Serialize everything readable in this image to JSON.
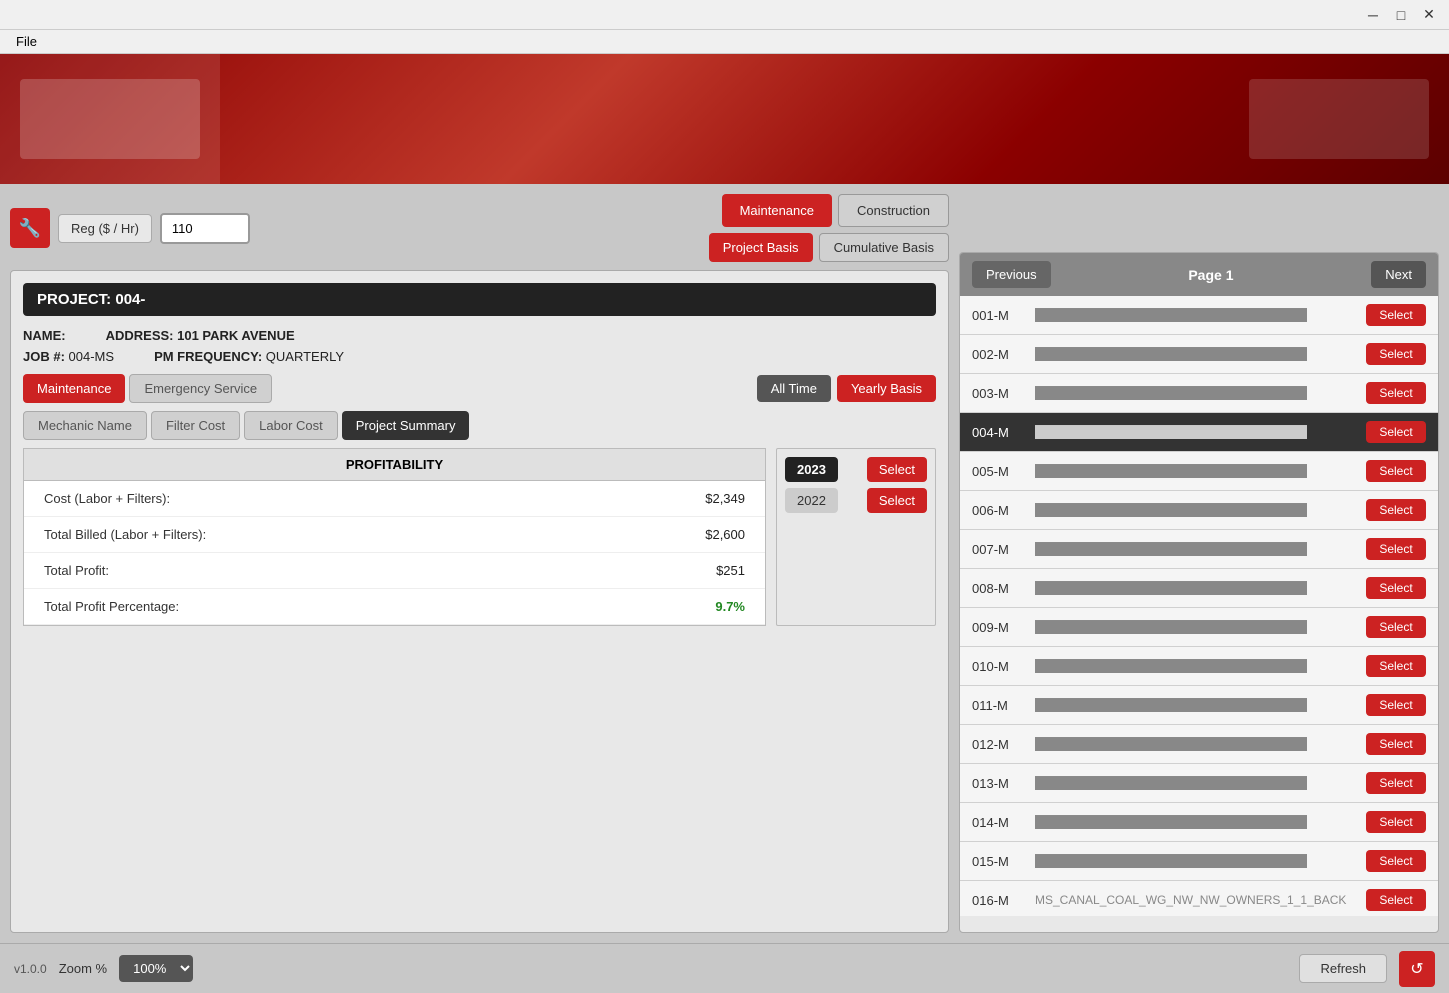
{
  "titlebar": {
    "min_btn": "─",
    "max_btn": "□",
    "close_btn": "✕"
  },
  "menubar": {
    "items": [
      "File"
    ]
  },
  "toolbar": {
    "wrench_icon": "🔧",
    "reg_label": "Reg ($ / Hr)",
    "rate_value": "110",
    "maintenance_label": "Maintenance",
    "construction_label": "Construction",
    "project_basis_label": "Project Basis",
    "cumulative_basis_label": "Cumulative Basis"
  },
  "project": {
    "title": "PROJECT: 004-",
    "name_label": "NAME:",
    "name_value": "████████████",
    "address_label": "ADDRESS: 101 PARK AVENUE",
    "address_value": "██",
    "job_label": "JOB #:",
    "job_value": "004-MS",
    "pm_freq_label": "PM FREQUENCY:",
    "pm_freq_value": "QUARTERLY"
  },
  "tabs": {
    "maintenance_label": "Maintenance",
    "emergency_service_label": "Emergency Service",
    "mechanic_name_label": "Mechanic Name",
    "filter_cost_label": "Filter Cost",
    "labor_cost_label": "Labor Cost",
    "project_summary_label": "Project Summary",
    "all_time_label": "All Time",
    "yearly_basis_label": "Yearly Basis"
  },
  "profitability": {
    "header": "PROFITABILITY",
    "rows": [
      {
        "label": "Cost (Labor + Filters):",
        "value": "$2,349",
        "type": "normal"
      },
      {
        "label": "Total Billed (Labor + Filters):",
        "value": "$2,600",
        "type": "normal"
      },
      {
        "label": "Total Profit:",
        "value": "$251",
        "type": "normal"
      },
      {
        "label": "Total Profit Percentage:",
        "value": "9.7%",
        "type": "green"
      }
    ]
  },
  "years": [
    {
      "year": "2023",
      "selected": true
    },
    {
      "year": "2022",
      "selected": false
    }
  ],
  "project_list": {
    "page_label": "Page 1",
    "prev_label": "Previous",
    "next_label": "Next",
    "select_label": "Select",
    "items": [
      {
        "id": "001-M",
        "name": "████████████████████████████████",
        "selected": false
      },
      {
        "id": "002-M",
        "name": "████████████████████████████████",
        "selected": false
      },
      {
        "id": "003-M",
        "name": "████████████████████████████████",
        "selected": false
      },
      {
        "id": "004-M",
        "name": "████████████████████████████████",
        "selected": true
      },
      {
        "id": "005-M",
        "name": "████████████████████████████████",
        "selected": false
      },
      {
        "id": "006-M",
        "name": "████████████████████████████████",
        "selected": false
      },
      {
        "id": "007-M",
        "name": "████████████████████████████████",
        "selected": false
      },
      {
        "id": "008-M",
        "name": "████████████████████████████████",
        "selected": false
      },
      {
        "id": "009-M",
        "name": "████████████████████████████████",
        "selected": false
      },
      {
        "id": "010-M",
        "name": "████████████████████████████████",
        "selected": false
      },
      {
        "id": "011-M",
        "name": "████████████████████████████████",
        "selected": false
      },
      {
        "id": "012-M",
        "name": "████████████████████████████████",
        "selected": false
      },
      {
        "id": "013-M",
        "name": "████████████████████████████████",
        "selected": false
      },
      {
        "id": "014-M",
        "name": "████████████████████████████████",
        "selected": false
      },
      {
        "id": "015-M",
        "name": "████████████████████████████████",
        "selected": false
      },
      {
        "id": "016-M",
        "name": "MS_CANAL_COAL_WG_NW_NW_OWNERS_1_1_BACK",
        "selected": false
      }
    ]
  },
  "bottombar": {
    "version_label": "v1.0.0",
    "zoom_label": "Zoom %",
    "zoom_value": "100%",
    "refresh_label": "Refresh",
    "refresh_icon": "↺"
  }
}
